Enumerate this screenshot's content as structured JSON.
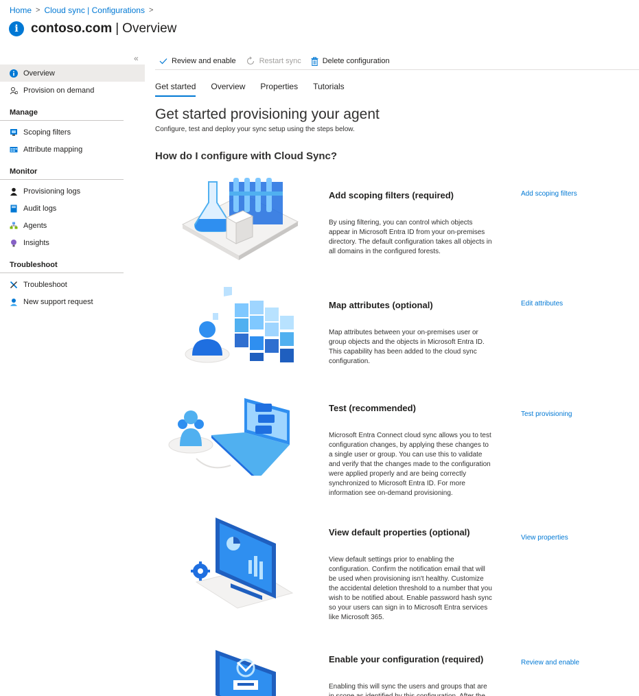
{
  "breadcrumb": {
    "home": "Home",
    "cloud_sync": "Cloud sync | Configurations"
  },
  "title": {
    "main": "contoso.com",
    "separator": "|",
    "sub": "Overview"
  },
  "sidebar": {
    "collapse": "«",
    "top_items": [
      {
        "label": "Overview",
        "icon": "info-icon"
      },
      {
        "label": "Provision on demand",
        "icon": "user-sync-icon"
      }
    ],
    "groups": [
      {
        "title": "Manage",
        "items": [
          {
            "label": "Scoping filters",
            "icon": "scoping-icon"
          },
          {
            "label": "Attribute mapping",
            "icon": "table-icon"
          }
        ]
      },
      {
        "title": "Monitor",
        "items": [
          {
            "label": "Provisioning logs",
            "icon": "person-icon"
          },
          {
            "label": "Audit logs",
            "icon": "book-icon"
          },
          {
            "label": "Agents",
            "icon": "agents-icon"
          },
          {
            "label": "Insights",
            "icon": "bulb-icon"
          }
        ]
      },
      {
        "title": "Troubleshoot",
        "items": [
          {
            "label": "Troubleshoot",
            "icon": "wrench-icon"
          },
          {
            "label": "New support request",
            "icon": "support-icon"
          }
        ]
      }
    ]
  },
  "toolbar": {
    "review": "Review and enable",
    "restart": "Restart sync",
    "delete": "Delete configuration"
  },
  "tabs": [
    "Get started",
    "Overview",
    "Properties",
    "Tutorials"
  ],
  "main": {
    "heading": "Get started provisioning your agent",
    "subheading": "Configure, test and deploy your sync setup using the steps below.",
    "section_title": "How do I configure with Cloud Sync?"
  },
  "steps": [
    {
      "title": "Add scoping filters (required)",
      "description": "By using filtering, you can control which objects appear in Microsoft Entra ID from your on-premises directory. The default configuration takes all objects in all domains in the configured forests.",
      "link": "Add scoping filters"
    },
    {
      "title": "Map attributes (optional)",
      "description": "Map attributes between your on-premises user or group objects and the objects in Microsoft Entra ID. This capability has been added to the cloud sync configuration.",
      "link": "Edit attributes"
    },
    {
      "title": "Test (recommended)",
      "description": "Microsoft Entra Connect cloud sync allows you to test configuration changes, by applying these changes to a single user or group. You can use this to validate and verify that the changes made to the configuration were applied properly and are being correctly synchronized to Microsoft Entra ID. For more information see on-demand provisioning.",
      "link": "Test provisioning"
    },
    {
      "title": "View default properties (optional)",
      "description": "View default settings prior to enabling the configuration. Confirm the notification email that will be used when provisioning isn't healthy. Customize the accidental deletion threshold to a number that you wish to be notified about. Enable password hash sync so your users can sign in to Microsoft Entra services like Microsoft 365.",
      "link": "View properties"
    },
    {
      "title": "Enable your configuration (required)",
      "description": "Enabling this will sync the users and groups that are in scope as identified by this configuration. After the",
      "link": "Review and enable"
    }
  ],
  "colors": {
    "accent": "#0078d4",
    "illustration_light": "#50b0f0",
    "illustration_dark": "#1f5fbf"
  }
}
